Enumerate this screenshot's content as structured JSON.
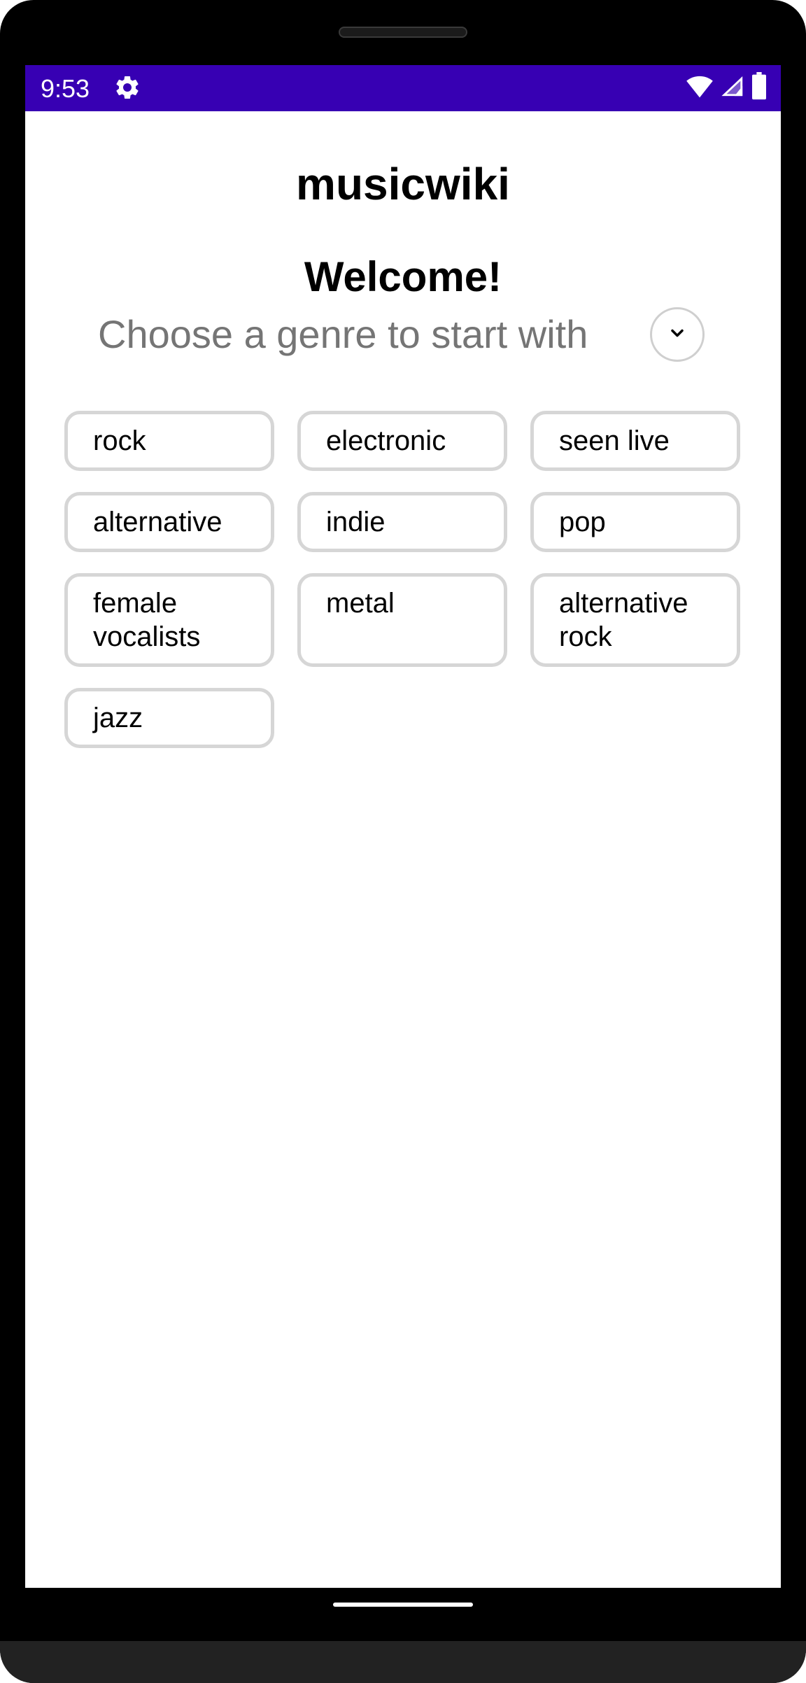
{
  "colors": {
    "status_bar": "#3700b3",
    "chip_border": "#d6d6d6",
    "subtitle_text": "#757575"
  },
  "status_bar": {
    "time": "9:53",
    "icons": [
      "settings-gear-icon",
      "wifi-icon",
      "cell-signal-icon",
      "battery-icon"
    ]
  },
  "app": {
    "title": "musicwiki"
  },
  "main": {
    "welcome": "Welcome!",
    "subtitle": "Choose a genre to start with",
    "expand_icon": "chevron-down-icon",
    "genres": [
      {
        "label": "rock"
      },
      {
        "label": "electronic"
      },
      {
        "label": "seen live"
      },
      {
        "label": "alternative"
      },
      {
        "label": "indie"
      },
      {
        "label": "pop"
      },
      {
        "label": "female vocalists"
      },
      {
        "label": "metal"
      },
      {
        "label": "alternative rock"
      },
      {
        "label": "jazz"
      }
    ]
  }
}
